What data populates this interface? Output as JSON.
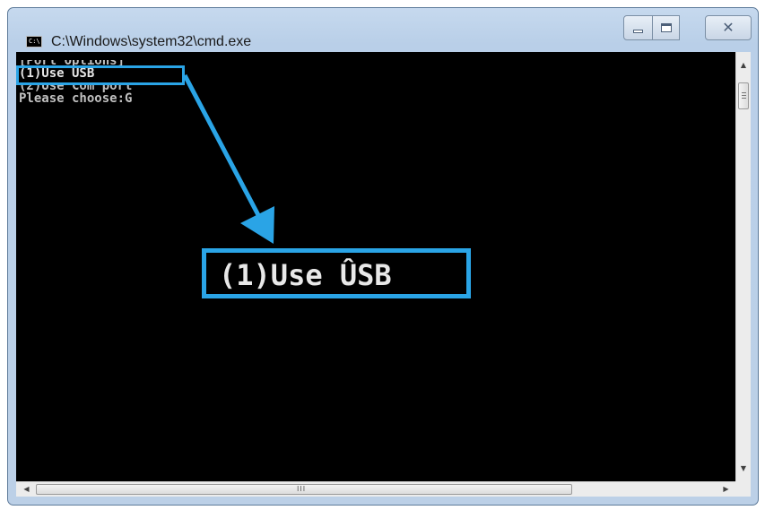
{
  "window": {
    "title": "C:\\Windows\\system32\\cmd.exe",
    "icon_label": "C:\\",
    "controls": {
      "minimize": "minimize-icon",
      "maximize": "maximize-icon",
      "close": "close-icon",
      "close_glyph": "✕"
    }
  },
  "console": {
    "lines": [
      "[Port Options]",
      "(1)Use USB",
      "(2)Use Com port",
      "Please choose:G"
    ],
    "callout_text": "(1)Use ÛSB",
    "text_color": "#c0c0c0",
    "background": "#000000"
  },
  "annotation": {
    "color": "#2aa4e6"
  },
  "scrollbars": {
    "up_arrow": "▲",
    "down_arrow": "▼",
    "left_arrow": "◀",
    "right_arrow": "▶",
    "h_grip": "III"
  }
}
